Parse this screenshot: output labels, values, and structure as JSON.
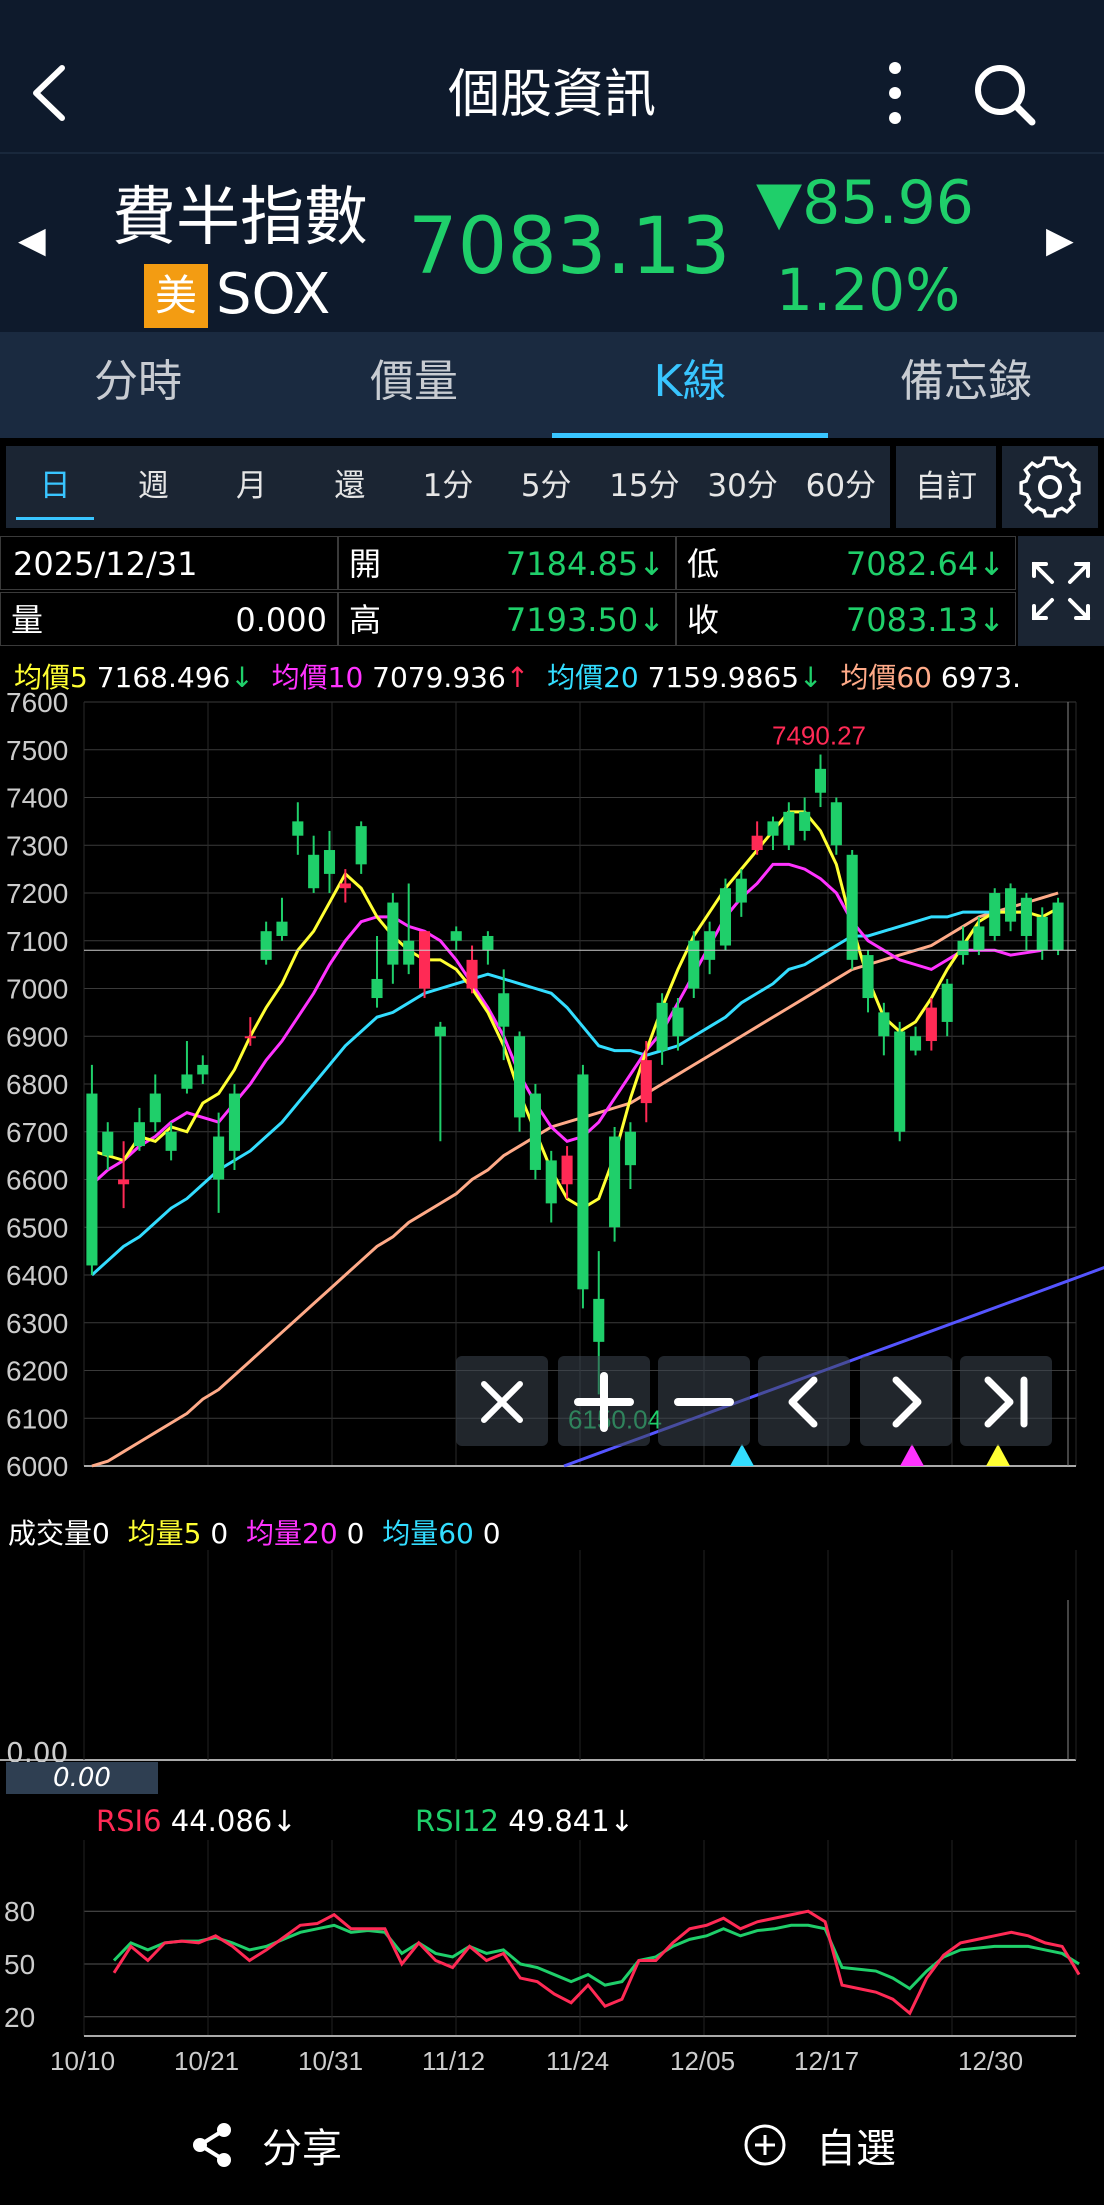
{
  "header": {
    "title": "個股資訊"
  },
  "quote": {
    "name": "費半指數",
    "market_badge": "美",
    "symbol": "SOX",
    "price": "7083.13",
    "change": "▼85.96",
    "change_pct": "1.20%",
    "down_color": "#1fcf6a",
    "up_color": "#ff2a55"
  },
  "tabs": [
    {
      "label": "分時"
    },
    {
      "label": "價量"
    },
    {
      "label": "K線"
    },
    {
      "label": "備忘錄"
    }
  ],
  "periods": [
    {
      "label": "日"
    },
    {
      "label": "週"
    },
    {
      "label": "月"
    },
    {
      "label": "還"
    },
    {
      "label": "1分"
    },
    {
      "label": "5分"
    },
    {
      "label": "15分"
    },
    {
      "label": "30分"
    },
    {
      "label": "60分"
    }
  ],
  "custom_label": "自訂",
  "ohlc": {
    "date": "2025/12/31",
    "open_label": "開",
    "open": "7184.85↓",
    "low_label": "低",
    "low": "7082.64↓",
    "vol_label": "量",
    "vol": "0.000",
    "high_label": "高",
    "high": "7193.50↓",
    "close_label": "收",
    "close": "7083.13↓"
  },
  "ma_legend": [
    {
      "label": "均價5",
      "value": "7168.496",
      "dir": "↓",
      "color": "#ffff33"
    },
    {
      "label": "均價10",
      "value": "7079.936",
      "dir": "↑",
      "color": "#ff33ff"
    },
    {
      "label": "均價20",
      "value": "7159.9865",
      "dir": "↓",
      "color": "#33ddff"
    },
    {
      "label": "均價60",
      "value": "6973.",
      "dir": "",
      "color": "#ffaa88"
    }
  ],
  "chart_data": {
    "type": "candlestick",
    "ylim": [
      6000,
      7600
    ],
    "yticks": [
      "7600",
      "7500",
      "7400",
      "7300",
      "7200",
      "7100",
      "7000",
      "6900",
      "6800",
      "6700",
      "6600",
      "6500",
      "6400",
      "6300",
      "6200",
      "6100",
      "6000"
    ],
    "xticks": [
      "10/10",
      "10/21",
      "10/31",
      "11/12",
      "11/24",
      "12/05",
      "12/17",
      "12/30"
    ],
    "high_annotation": "7490.27",
    "low_annotation": "6150.04",
    "candles": [
      [
        6780,
        6420,
        6840,
        6400
      ],
      [
        6700,
        6650,
        6720,
        6620
      ],
      [
        6590,
        6600,
        6680,
        6540
      ],
      [
        6720,
        6670,
        6750,
        6660
      ],
      [
        6780,
        6720,
        6820,
        6700
      ],
      [
        6700,
        6660,
        6720,
        6640
      ],
      [
        6820,
        6790,
        6890,
        6780
      ],
      [
        6840,
        6820,
        6860,
        6800
      ],
      [
        6690,
        6600,
        6740,
        6530
      ],
      [
        6780,
        6660,
        6800,
        6620
      ],
      [
        6900,
        6900,
        6940,
        6880
      ],
      [
        7120,
        7060,
        7140,
        7050
      ],
      [
        7140,
        7110,
        7190,
        7100
      ],
      [
        7350,
        7320,
        7390,
        7280
      ],
      [
        7280,
        7210,
        7320,
        7200
      ],
      [
        7290,
        7240,
        7330,
        7200
      ],
      [
        7210,
        7220,
        7250,
        7180
      ],
      [
        7340,
        7260,
        7350,
        7240
      ],
      [
        7020,
        6980,
        7110,
        6960
      ],
      [
        7180,
        7050,
        7200,
        7010
      ],
      [
        7100,
        7050,
        7220,
        7030
      ],
      [
        7000,
        7120,
        7120,
        6980
      ],
      [
        6920,
        6900,
        6930,
        6680
      ],
      [
        7120,
        7100,
        7130,
        7080
      ],
      [
        7000,
        7060,
        7090,
        6990
      ],
      [
        7110,
        7080,
        7120,
        7050
      ],
      [
        6990,
        6920,
        7040,
        6850
      ],
      [
        6900,
        6730,
        6910,
        6700
      ],
      [
        6780,
        6620,
        6800,
        6600
      ],
      [
        6640,
        6550,
        6660,
        6510
      ],
      [
        6590,
        6650,
        6670,
        6560
      ],
      [
        6820,
        6370,
        6840,
        6330
      ],
      [
        6350,
        6260,
        6450,
        6150
      ],
      [
        6690,
        6500,
        6710,
        6470
      ],
      [
        6700,
        6630,
        6720,
        6580
      ],
      [
        6760,
        6850,
        6890,
        6720
      ],
      [
        6970,
        6870,
        6990,
        6840
      ],
      [
        6960,
        6900,
        6980,
        6870
      ],
      [
        7100,
        7000,
        7120,
        6980
      ],
      [
        7120,
        7060,
        7140,
        7030
      ],
      [
        7210,
        7090,
        7230,
        7080
      ],
      [
        7230,
        7180,
        7250,
        7150
      ],
      [
        7290,
        7320,
        7350,
        7280
      ],
      [
        7350,
        7320,
        7360,
        7290
      ],
      [
        7370,
        7300,
        7390,
        7290
      ],
      [
        7370,
        7330,
        7400,
        7310
      ],
      [
        7460,
        7410,
        7490,
        7380
      ],
      [
        7390,
        7300,
        7400,
        7280
      ],
      [
        7280,
        7060,
        7290,
        7040
      ],
      [
        7070,
        6980,
        7080,
        6950
      ],
      [
        6950,
        6900,
        6970,
        6860
      ],
      [
        6910,
        6700,
        6930,
        6680
      ],
      [
        6900,
        6870,
        6920,
        6860
      ],
      [
        6890,
        6960,
        6980,
        6870
      ],
      [
        7010,
        6930,
        7020,
        6900
      ],
      [
        7100,
        7070,
        7130,
        7050
      ],
      [
        7130,
        7080,
        7150,
        7070
      ],
      [
        7200,
        7110,
        7210,
        7100
      ],
      [
        7210,
        7140,
        7220,
        7120
      ],
      [
        7190,
        7110,
        7200,
        7080
      ],
      [
        7150,
        7080,
        7170,
        7060
      ],
      [
        7180,
        7080,
        7190,
        7070
      ]
    ],
    "ma5": [
      6660,
      6650,
      6640,
      6690,
      6680,
      6710,
      6700,
      6760,
      6780,
      6830,
      6900,
      6960,
      7010,
      7080,
      7120,
      7180,
      7240,
      7210,
      7150,
      7110,
      7080,
      7060,
      7060,
      7040,
      7000,
      6950,
      6880,
      6780,
      6700,
      6620,
      6560,
      6540,
      6560,
      6650,
      6770,
      6870,
      6960,
      7040,
      7110,
      7160,
      7210,
      7250,
      7290,
      7330,
      7370,
      7370,
      7330,
      7260,
      7130,
      7020,
      6940,
      6910,
      6930,
      6980,
      7040,
      7090,
      7140,
      7160,
      7160,
      7160,
      7150,
      7168
    ],
    "ma10": [
      6590,
      6620,
      6640,
      6670,
      6690,
      6720,
      6740,
      6730,
      6720,
      6760,
      6800,
      6850,
      6890,
      6940,
      6990,
      7050,
      7100,
      7140,
      7150,
      7150,
      7130,
      7120,
      7100,
      7060,
      7010,
      6960,
      6900,
      6820,
      6760,
      6710,
      6680,
      6690,
      6720,
      6770,
      6820,
      6870,
      6910,
      6970,
      7030,
      7090,
      7150,
      7190,
      7220,
      7260,
      7260,
      7250,
      7230,
      7200,
      7140,
      7100,
      7080,
      7060,
      7050,
      7040,
      7060,
      7080,
      7080,
      7080,
      7070,
      7075,
      7080
    ],
    "ma20": [
      6400,
      6430,
      6460,
      6480,
      6510,
      6540,
      6560,
      6590,
      6620,
      6640,
      6660,
      6690,
      6720,
      6760,
      6800,
      6840,
      6880,
      6910,
      6940,
      6950,
      6970,
      6990,
      7000,
      7010,
      7020,
      7030,
      7020,
      7010,
      7000,
      6990,
      6960,
      6920,
      6880,
      6870,
      6870,
      6860,
      6870,
      6880,
      6900,
      6920,
      6940,
      6970,
      6990,
      7010,
      7040,
      7050,
      7070,
      7090,
      7110,
      7110,
      7120,
      7130,
      7140,
      7150,
      7150,
      7160,
      7160,
      7160,
      7160,
      7160
    ],
    "ma60": [
      6000,
      6010,
      6030,
      6050,
      6070,
      6090,
      6110,
      6140,
      6160,
      6190,
      6220,
      6250,
      6280,
      6310,
      6340,
      6370,
      6400,
      6430,
      6460,
      6480,
      6510,
      6530,
      6550,
      6570,
      6600,
      6620,
      6650,
      6670,
      6690,
      6710,
      6720,
      6730,
      6740,
      6750,
      6760,
      6780,
      6800,
      6820,
      6840,
      6860,
      6880,
      6900,
      6920,
      6940,
      6960,
      6980,
      7000,
      7020,
      7040,
      7050,
      7060,
      7070,
      7080,
      7090,
      7110,
      7130,
      7150,
      7160,
      7170,
      7180,
      7190,
      7200
    ],
    "ma_long": [
      6000,
      6020,
      6040,
      6060,
      6080,
      6100,
      6120,
      6140,
      6160,
      6180,
      6200,
      6220,
      6240,
      6260,
      6280,
      6300,
      6320,
      6340,
      6360,
      6380,
      6400,
      6420,
      6430
    ]
  },
  "controls": [
    "close",
    "zoom-in",
    "zoom-out",
    "prev",
    "next",
    "last"
  ],
  "volume": {
    "legend": [
      {
        "label": "成交量",
        "value": "0",
        "color": "#ffffff"
      },
      {
        "label": "均量5",
        "value": "0",
        "color": "#ffff33"
      },
      {
        "label": "均量20",
        "value": "0",
        "color": "#ff33ff"
      },
      {
        "label": "均量60",
        "value": "0",
        "color": "#33ddff"
      }
    ],
    "axis_zero": "0.00",
    "current_tag": "0.00"
  },
  "rsi": {
    "rsi6_label": "RSI6",
    "rsi6_value": "44.086↓",
    "rsi6_color": "#ff2a55",
    "rsi12_label": "RSI12",
    "rsi12_value": "49.841↓",
    "rsi12_color": "#1fcf6a",
    "yticks": [
      "80",
      "50",
      "20"
    ],
    "rsi6": [
      45,
      60,
      52,
      62,
      63,
      62,
      66,
      60,
      52,
      58,
      65,
      72,
      73,
      78,
      70,
      70,
      70,
      50,
      62,
      52,
      48,
      60,
      52,
      56,
      42,
      40,
      33,
      28,
      38,
      26,
      30,
      52,
      52,
      62,
      70,
      72,
      76,
      70,
      74,
      76,
      78,
      80,
      74,
      38,
      36,
      34,
      30,
      22,
      42,
      55,
      62,
      64,
      66,
      68,
      66,
      62,
      60,
      44
    ],
    "rsi12": [
      52,
      62,
      58,
      62,
      63,
      63,
      65,
      62,
      58,
      60,
      64,
      68,
      70,
      72,
      68,
      69,
      68,
      56,
      62,
      56,
      54,
      60,
      56,
      58,
      50,
      48,
      44,
      40,
      44,
      38,
      40,
      52,
      54,
      60,
      64,
      66,
      70,
      66,
      69,
      70,
      72,
      72,
      70,
      48,
      47,
      46,
      42,
      36,
      46,
      54,
      58,
      59,
      60,
      60,
      60,
      58,
      56,
      50
    ]
  },
  "bottom": {
    "share_label": "分享",
    "watch_label": "自選"
  }
}
